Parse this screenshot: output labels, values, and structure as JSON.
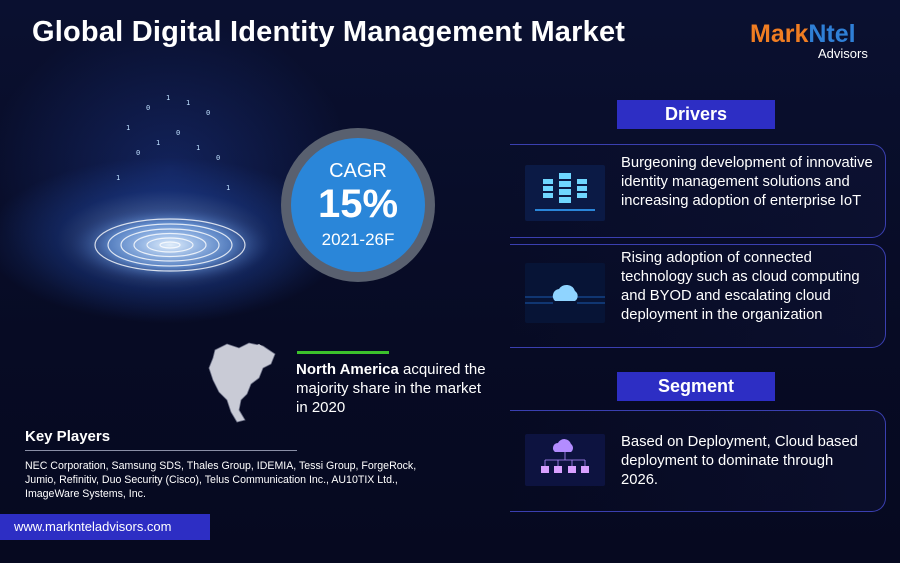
{
  "title": {
    "bold": "Global",
    "rest": " Digital Identity Management Market"
  },
  "logo": {
    "part1": "Mark",
    "part2": "Ntel",
    "sub": "Advisors"
  },
  "cagr": {
    "label": "CAGR",
    "value": "15%",
    "period": "2021-26F"
  },
  "region": {
    "name": "North America",
    "text": " acquired the majority share in the market in 2020"
  },
  "key_players": {
    "title": "Key Players",
    "list": "NEC Corporation, Samsung SDS, Thales Group, IDEMIA, Tessi Group, ForgeRock, Jumio, Refinitiv, Duo Security (Cisco), Telus Communication Inc., AU10TIX Ltd., ImageWare Systems, Inc."
  },
  "website": "www.marknteladvisors.com",
  "drivers": {
    "label": "Drivers",
    "items": [
      {
        "text": "Burgeoning development of innovative identity management solutions and increasing adoption of enterprise IoT",
        "icon": "server-stack-icon"
      },
      {
        "text": "Rising adoption of connected technology such as cloud computing and BYOD and escalating cloud deployment in the organization",
        "icon": "cloud-icon"
      }
    ]
  },
  "segment": {
    "label": "Segment",
    "items": [
      {
        "text": "Based on Deployment, Cloud based deployment to dominate through 2026.",
        "icon": "cloud-network-icon"
      }
    ]
  },
  "colors": {
    "background": "#070b24",
    "accent_blue": "#2d2ec4",
    "cagr_blue": "#2a86d9",
    "logo_orange": "#f07d22",
    "logo_blue": "#2f7fd6",
    "highlight_green": "#3cc22c"
  }
}
